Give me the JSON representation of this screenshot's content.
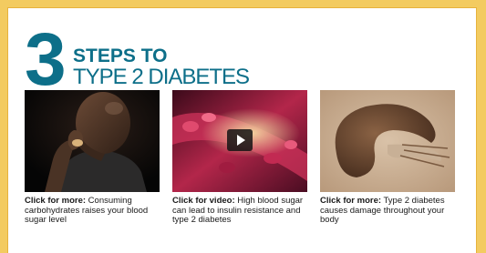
{
  "header": {
    "big_number": "3",
    "line1": "STEPS TO",
    "line2": "TYPE 2 DIABETES"
  },
  "cards": [
    {
      "lead": "Click for more:",
      "text": " Consuming carbohydrates raises your blood sugar level",
      "image": "man-eating-photo"
    },
    {
      "lead": "Click for video:",
      "text": " High blood sugar can lead to insulin resistance and type 2 diabetes",
      "image": "blood-vessel-video"
    },
    {
      "lead": "Click for more:",
      "text": " Type 2 diabetes causes damage throughout your body",
      "image": "pancreas-illustration"
    }
  ],
  "colors": {
    "accent": "#0d6f89",
    "frame": "#f3cb60"
  },
  "icons": {
    "video": "play-icon"
  }
}
